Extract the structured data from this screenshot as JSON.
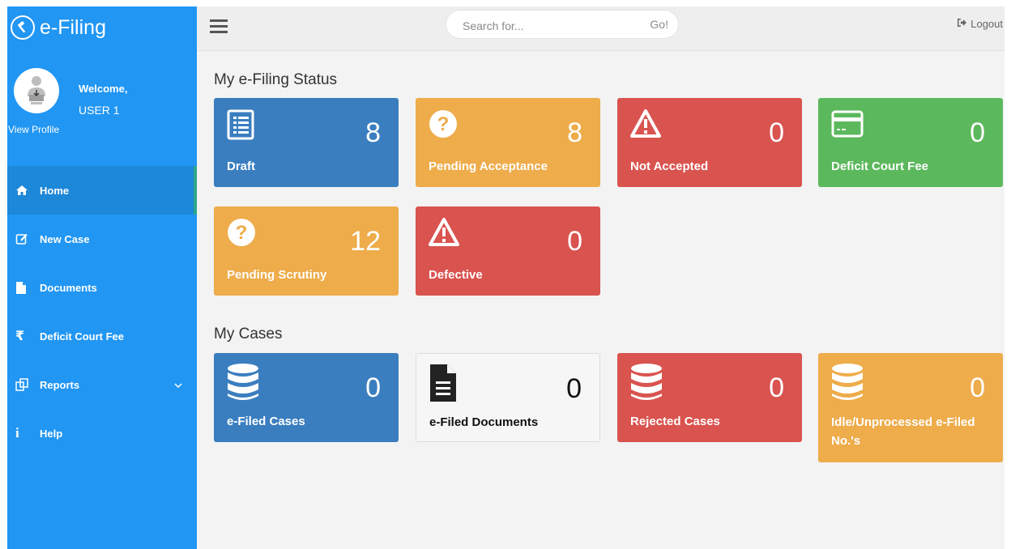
{
  "sidebar": {
    "brand": "e-Filing",
    "welcome": "Welcome,",
    "username": "USER 1",
    "view_profile": "View Profile",
    "items": [
      {
        "label": "Home",
        "icon": "home-icon"
      },
      {
        "label": "New Case",
        "icon": "edit-icon"
      },
      {
        "label": "Documents",
        "icon": "document-icon"
      },
      {
        "label": "Deficit Court Fee",
        "icon": "rupee-icon"
      },
      {
        "label": "Reports",
        "icon": "reports-icon"
      },
      {
        "label": "Help",
        "icon": "info-icon"
      }
    ]
  },
  "topbar": {
    "search_placeholder": "Search for...",
    "go_label": "Go!",
    "logout_label": "Logout"
  },
  "status": {
    "title": "My e-Filing Status",
    "cards": [
      {
        "label": "Draft",
        "count": "8",
        "color": "#3a7ebf",
        "icon": "list-icon"
      },
      {
        "label": "Pending Acceptance",
        "count": "8",
        "color": "#eeac4b",
        "icon": "question-icon"
      },
      {
        "label": "Not Accepted",
        "count": "0",
        "color": "#d9534f",
        "icon": "warning-icon"
      },
      {
        "label": "Deficit Court Fee",
        "count": "0",
        "color": "#5cb85c",
        "icon": "credit-card-icon"
      },
      {
        "label": "Pending Scrutiny",
        "count": "12",
        "color": "#eeac4b",
        "icon": "question-icon"
      },
      {
        "label": "Defective",
        "count": "0",
        "color": "#d9534f",
        "icon": "warning-icon"
      }
    ]
  },
  "cases": {
    "title": "My Cases",
    "cards": [
      {
        "label": "e-Filed Cases",
        "count": "0",
        "color": "#3a7ebf",
        "icon": "database-icon"
      },
      {
        "label": "e-Filed Documents",
        "count": "0",
        "color": "#f6f6f6",
        "icon": "file-icon"
      },
      {
        "label": "Rejected Cases",
        "count": "0",
        "color": "#d9534f",
        "icon": "database-icon"
      },
      {
        "label": "Idle/Unprocessed e-Filed No.'s",
        "count": "0",
        "color": "#eeac4b",
        "icon": "database-icon"
      }
    ]
  }
}
